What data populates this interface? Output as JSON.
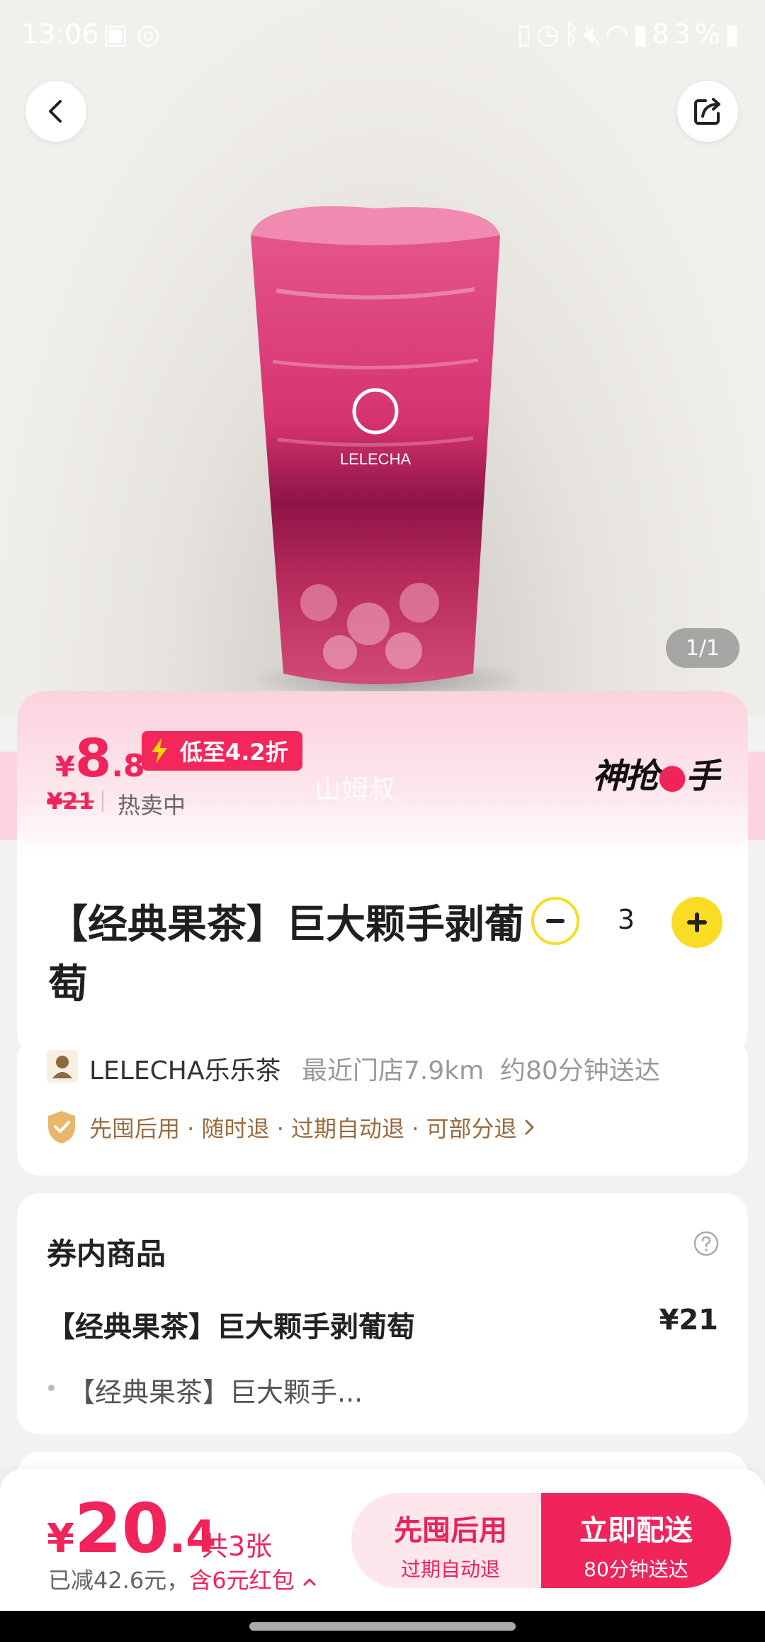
{
  "status_bar": {
    "time": "13:06",
    "left_icons": [
      "image-icon",
      "sync-icon"
    ],
    "right_icons": [
      "sim-icon",
      "alarm-icon",
      "bluetooth-icon",
      "mute-icon",
      "wifi-icon",
      "hd-icon",
      "signal-icon",
      "battery-icon"
    ],
    "battery": "83%"
  },
  "hero": {
    "page_indicator": "1/1",
    "cup_logo_text": "LELECHA"
  },
  "price": {
    "currency": "¥",
    "integer": "8",
    "decimal": ".8",
    "discount_tag": "低至4.2折",
    "original": "¥21",
    "status": "热卖中",
    "watermark": "山姆叔",
    "brand_main": "神抢",
    "brand_dot": "",
    "brand_end": "手"
  },
  "product": {
    "title": "【经典果茶】巨大颗手剥葡萄",
    "quantity": "3"
  },
  "store": {
    "name": "LELECHA乐乐茶",
    "distance": "最近门店7.9km",
    "delivery": "约80分钟送达",
    "guarantee": "先囤后用 · 随时退 · 过期自动退 · 可部分退"
  },
  "items_card": {
    "title": "券内商品",
    "item_name": "【经典果茶】巨大颗手剥葡萄",
    "item_price": "¥21",
    "sub_item": "【经典果茶】巨大颗手..."
  },
  "bottom_bar": {
    "currency": "¥",
    "integer": "20",
    "decimal": ".4",
    "count": "共3张",
    "saved_prefix": "已减42.6元，",
    "saved_highlight": "含6元红包",
    "btn_later_main": "先囤后用",
    "btn_later_sub": "过期自动退",
    "btn_now_main": "立即配送",
    "btn_now_sub": "80分钟送达"
  },
  "colors": {
    "accent": "#f0245a",
    "stepper_yellow": "#fbdc24",
    "guarantee_brown": "#9a6b3e"
  }
}
